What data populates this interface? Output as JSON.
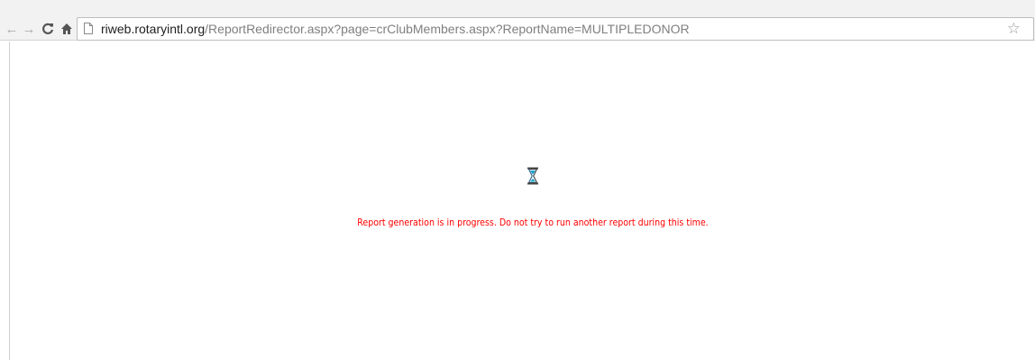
{
  "browser": {
    "back_icon": "arrow-left-icon",
    "forward_icon": "arrow-right-icon",
    "reload_icon": "reload-icon",
    "home_icon": "home-icon",
    "page_icon": "page-icon",
    "bookmark_icon": "star-icon",
    "url_host": "riweb.rotaryintl.org",
    "url_path": "/ReportRedirector.aspx?page=crClubMembers.aspx?ReportName=MULTIPLEDONOR"
  },
  "page": {
    "loading_icon": "hourglass-icon",
    "message": "Report generation is in progress. Do not try to run another report during this time.",
    "message_color": "#ff0000"
  }
}
